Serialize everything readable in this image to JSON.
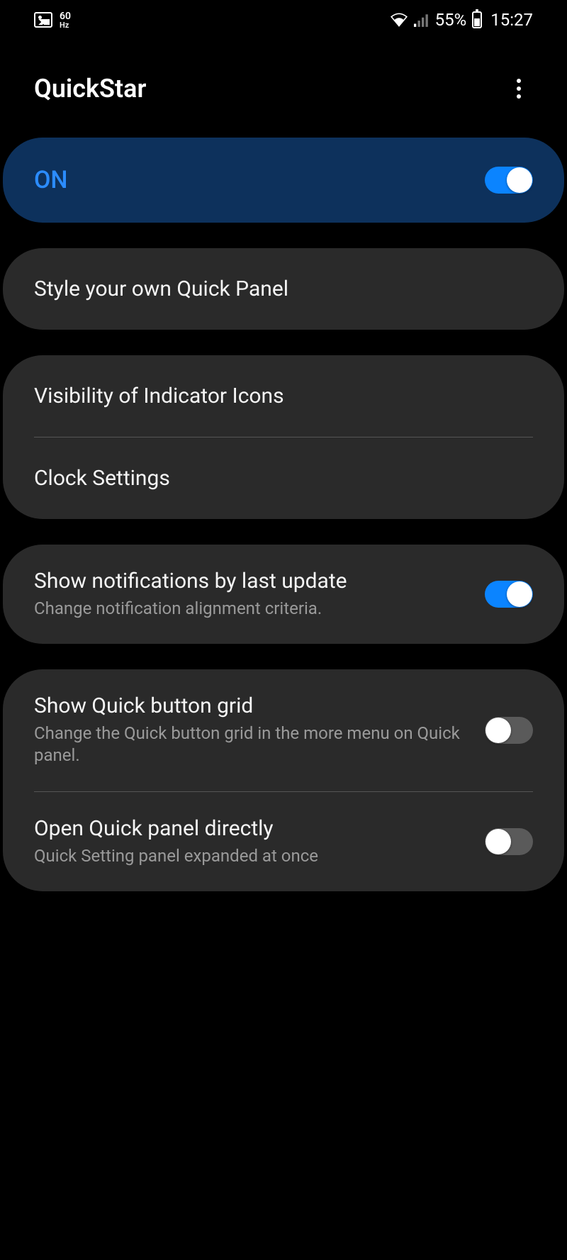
{
  "status_bar": {
    "hz_top": "60",
    "hz_bot": "Hz",
    "battery_pct": "55%",
    "time": "15:27"
  },
  "header": {
    "title": "QuickStar"
  },
  "master_toggle": {
    "label": "ON",
    "on": true
  },
  "cards": [
    {
      "rows": [
        {
          "title": "Style your own Quick Panel",
          "sub": null,
          "toggle": null
        }
      ]
    },
    {
      "rows": [
        {
          "title": "Visibility of Indicator Icons",
          "sub": null,
          "toggle": null
        },
        {
          "title": "Clock Settings",
          "sub": null,
          "toggle": null
        }
      ]
    },
    {
      "rows": [
        {
          "title": "Show notifications by last update",
          "sub": "Change notification alignment criteria.",
          "toggle": true
        }
      ]
    },
    {
      "rows": [
        {
          "title": "Show Quick button grid",
          "sub": "Change the Quick button grid in the more menu on Quick panel.",
          "toggle": false
        },
        {
          "title": "Open Quick panel directly",
          "sub": "Quick Setting panel expanded at once",
          "toggle": false
        }
      ]
    }
  ]
}
